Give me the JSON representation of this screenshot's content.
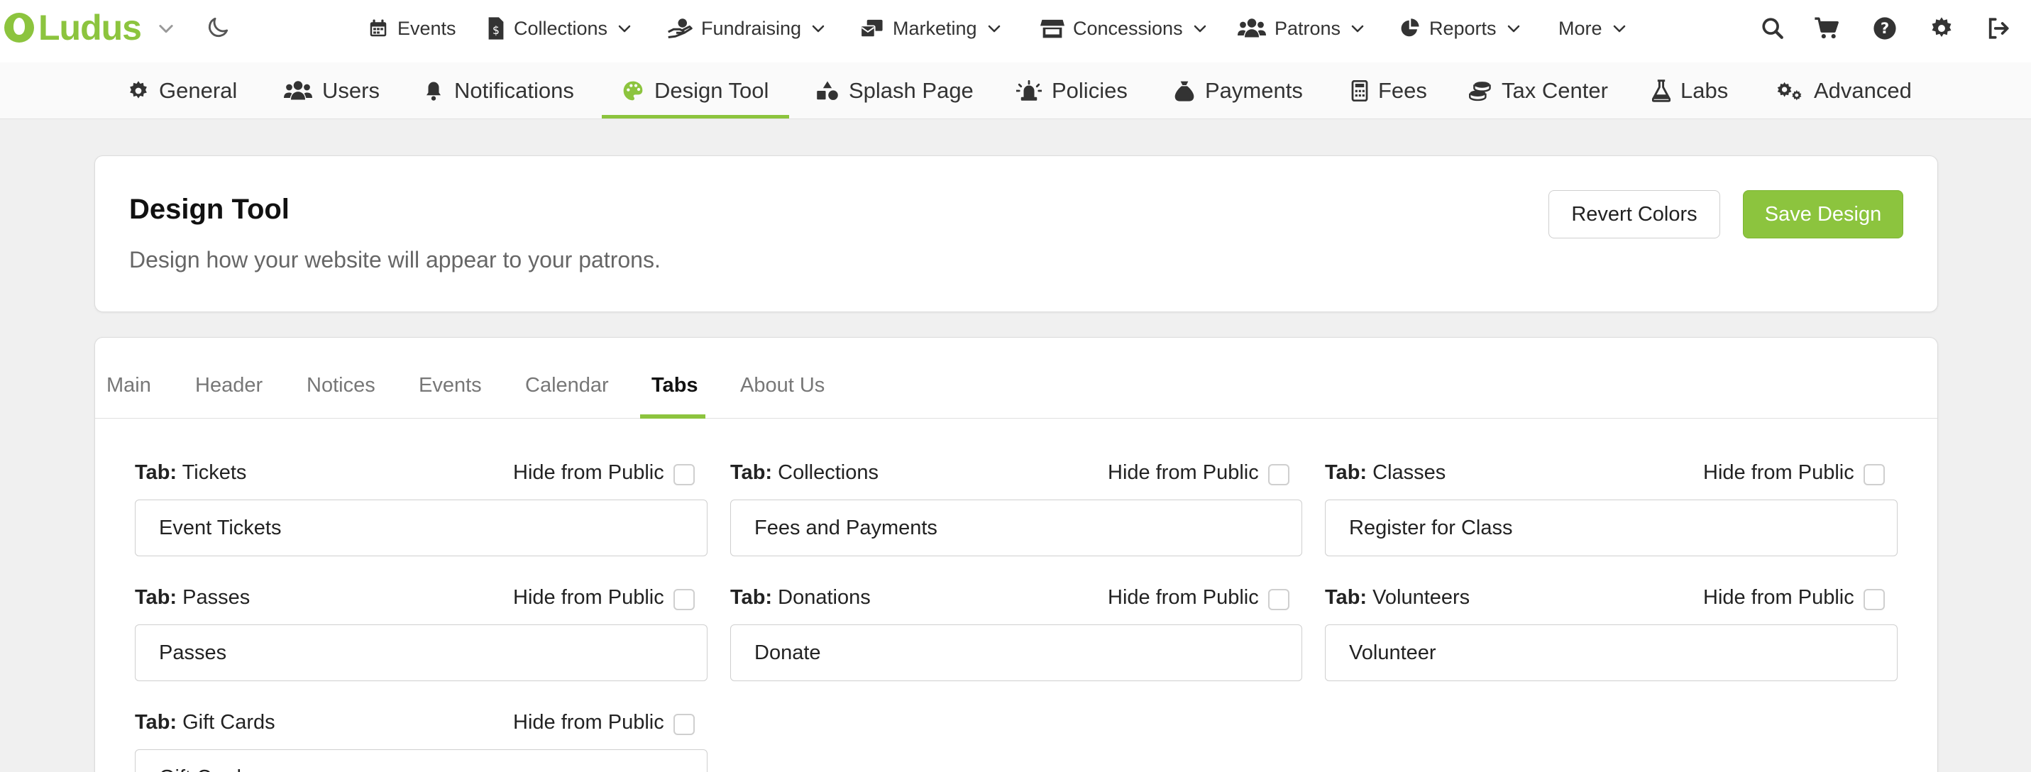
{
  "brand": {
    "name": "Ludus",
    "color": "#8cc43e"
  },
  "top_nav": [
    {
      "label": "Events",
      "icon": "calendar-icon"
    },
    {
      "label": "Collections",
      "icon": "invoice-icon"
    },
    {
      "label": "Fundraising",
      "icon": "hand-donate-icon"
    },
    {
      "label": "Marketing",
      "icon": "mail-bulk-icon"
    },
    {
      "label": "Concessions",
      "icon": "store-icon"
    },
    {
      "label": "Patrons",
      "icon": "users-icon"
    },
    {
      "label": "Reports",
      "icon": "pie-chart-icon"
    },
    {
      "label": "More",
      "icon": ""
    }
  ],
  "top_right_icons": [
    "search-icon",
    "cart-icon",
    "help-icon",
    "gear-icon",
    "sign-out-icon"
  ],
  "settings_tabs": [
    {
      "label": "General",
      "icon": "gear-icon"
    },
    {
      "label": "Users",
      "icon": "users-icon"
    },
    {
      "label": "Notifications",
      "icon": "bell-icon"
    },
    {
      "label": "Design Tool",
      "icon": "palette-icon",
      "active": true
    },
    {
      "label": "Splash Page",
      "icon": "shapes-icon"
    },
    {
      "label": "Policies",
      "icon": "siren-icon"
    },
    {
      "label": "Payments",
      "icon": "money-bag-icon"
    },
    {
      "label": "Fees",
      "icon": "calculator-icon"
    },
    {
      "label": "Tax Center",
      "icon": "coins-icon"
    },
    {
      "label": "Labs",
      "icon": "flask-icon"
    },
    {
      "label": "Advanced",
      "icon": "gears-icon"
    }
  ],
  "header_card": {
    "title": "Design Tool",
    "subtitle": "Design how your website will appear to your patrons.",
    "revert_label": "Revert Colors",
    "save_label": "Save Design"
  },
  "design_tabs": [
    {
      "label": "Main"
    },
    {
      "label": "Header"
    },
    {
      "label": "Notices"
    },
    {
      "label": "Events"
    },
    {
      "label": "Calendar"
    },
    {
      "label": "Tabs",
      "active": true
    },
    {
      "label": "About Us"
    }
  ],
  "tab_prefix": "Tab:",
  "hide_label": "Hide from Public",
  "tab_fields": [
    {
      "name": "Tickets",
      "value": "Event Tickets",
      "hidden": false
    },
    {
      "name": "Collections",
      "value": "Fees and Payments",
      "hidden": false
    },
    {
      "name": "Classes",
      "value": "Register for Class",
      "hidden": false
    },
    {
      "name": "Passes",
      "value": "Passes",
      "hidden": false
    },
    {
      "name": "Donations",
      "value": "Donate",
      "hidden": false
    },
    {
      "name": "Volunteers",
      "value": "Volunteer",
      "hidden": false
    },
    {
      "name": "Gift Cards",
      "value": "Gift Cards",
      "hidden": false
    }
  ]
}
